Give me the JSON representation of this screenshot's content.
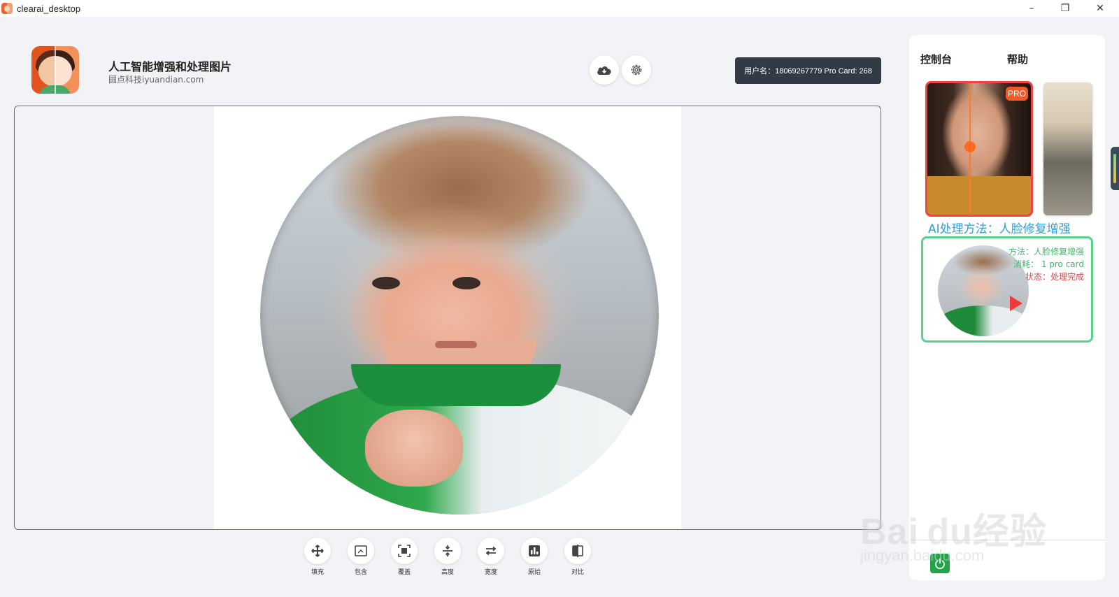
{
  "window": {
    "title": "clearai_desktop",
    "minimize": "–",
    "maximize": "❐",
    "close": "✕"
  },
  "header": {
    "title": "人工智能增强和处理图片",
    "subtitle": "圆点科技iyuandian.com",
    "user_info": "用户名：18069267779 Pro Card: 268",
    "cloud_icon": "cloud-download-icon",
    "settings_icon": "gear-icon"
  },
  "toolbar": {
    "items": [
      {
        "label": "填充",
        "icon": "move-icon"
      },
      {
        "label": "包含",
        "icon": "contain-icon"
      },
      {
        "label": "覆盖",
        "icon": "cover-icon"
      },
      {
        "label": "高度",
        "icon": "fit-height-icon"
      },
      {
        "label": "宽度",
        "icon": "fit-width-icon"
      },
      {
        "label": "原始",
        "icon": "original-icon"
      },
      {
        "label": "对比",
        "icon": "compare-icon"
      }
    ]
  },
  "sidebar": {
    "tabs": [
      {
        "label": "控制台"
      },
      {
        "label": "帮助"
      }
    ],
    "pro_badge": "PRO",
    "method_title": "AI处理方法：人脸修复增强",
    "result": {
      "method": "方法：人脸修复增强",
      "cost": "消耗： 1 pro card",
      "status": "状态：处理完成"
    }
  },
  "watermark": {
    "brand": "Bai du经验",
    "url": "jingyan.baidu.com"
  },
  "colors": {
    "accent_red": "#ee4444",
    "accent_green": "#5ad38a",
    "method_blue": "#2f9fd8",
    "pill_dark": "#323a45"
  }
}
